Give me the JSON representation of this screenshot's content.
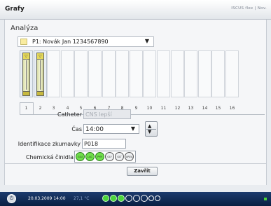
{
  "app": {
    "title": "Grafy",
    "brand": "ISCUS flex | Nov."
  },
  "window": {
    "heading": "Analýza"
  },
  "patient": {
    "selected": "P1: Novák Jan 1234567890",
    "dropdown_glyph": "▼"
  },
  "rack": {
    "slots": [
      "1",
      "2",
      "3",
      "4",
      "5",
      "6",
      "7",
      "8",
      "9",
      "10",
      "11",
      "12",
      "13",
      "14",
      "15",
      "16"
    ],
    "selected_slot": "1",
    "tube_cap_label": "▽"
  },
  "form": {
    "catheter_label": "Catheter",
    "catheter_value": "CNS lepší",
    "time_label": "Čas",
    "time_value": "14:00",
    "time_dropdown_glyph": "▼",
    "sample_id_label": "Identifikace zkumavky",
    "sample_id_value": "P018",
    "reagents_label": "Chemická činidla",
    "reagents": [
      {
        "code": "GLU",
        "active": true
      },
      {
        "code": "LAC",
        "active": true
      },
      {
        "code": "PYR",
        "active": true
      },
      {
        "code": "GLY",
        "active": false
      },
      {
        "code": "GLT",
        "active": false
      },
      {
        "code": "UREA",
        "active": false
      }
    ],
    "spinner_up": "▲",
    "spinner_down": "▼"
  },
  "actions": {
    "close_label": "Zavřít"
  },
  "statusbar": {
    "power_glyph": "⏻",
    "datetime": "20.03.2009 14:00",
    "temperature": "27,1 °C",
    "indicator_colors": {
      "active": "#4ad43b",
      "inactive": "transparent"
    }
  }
}
